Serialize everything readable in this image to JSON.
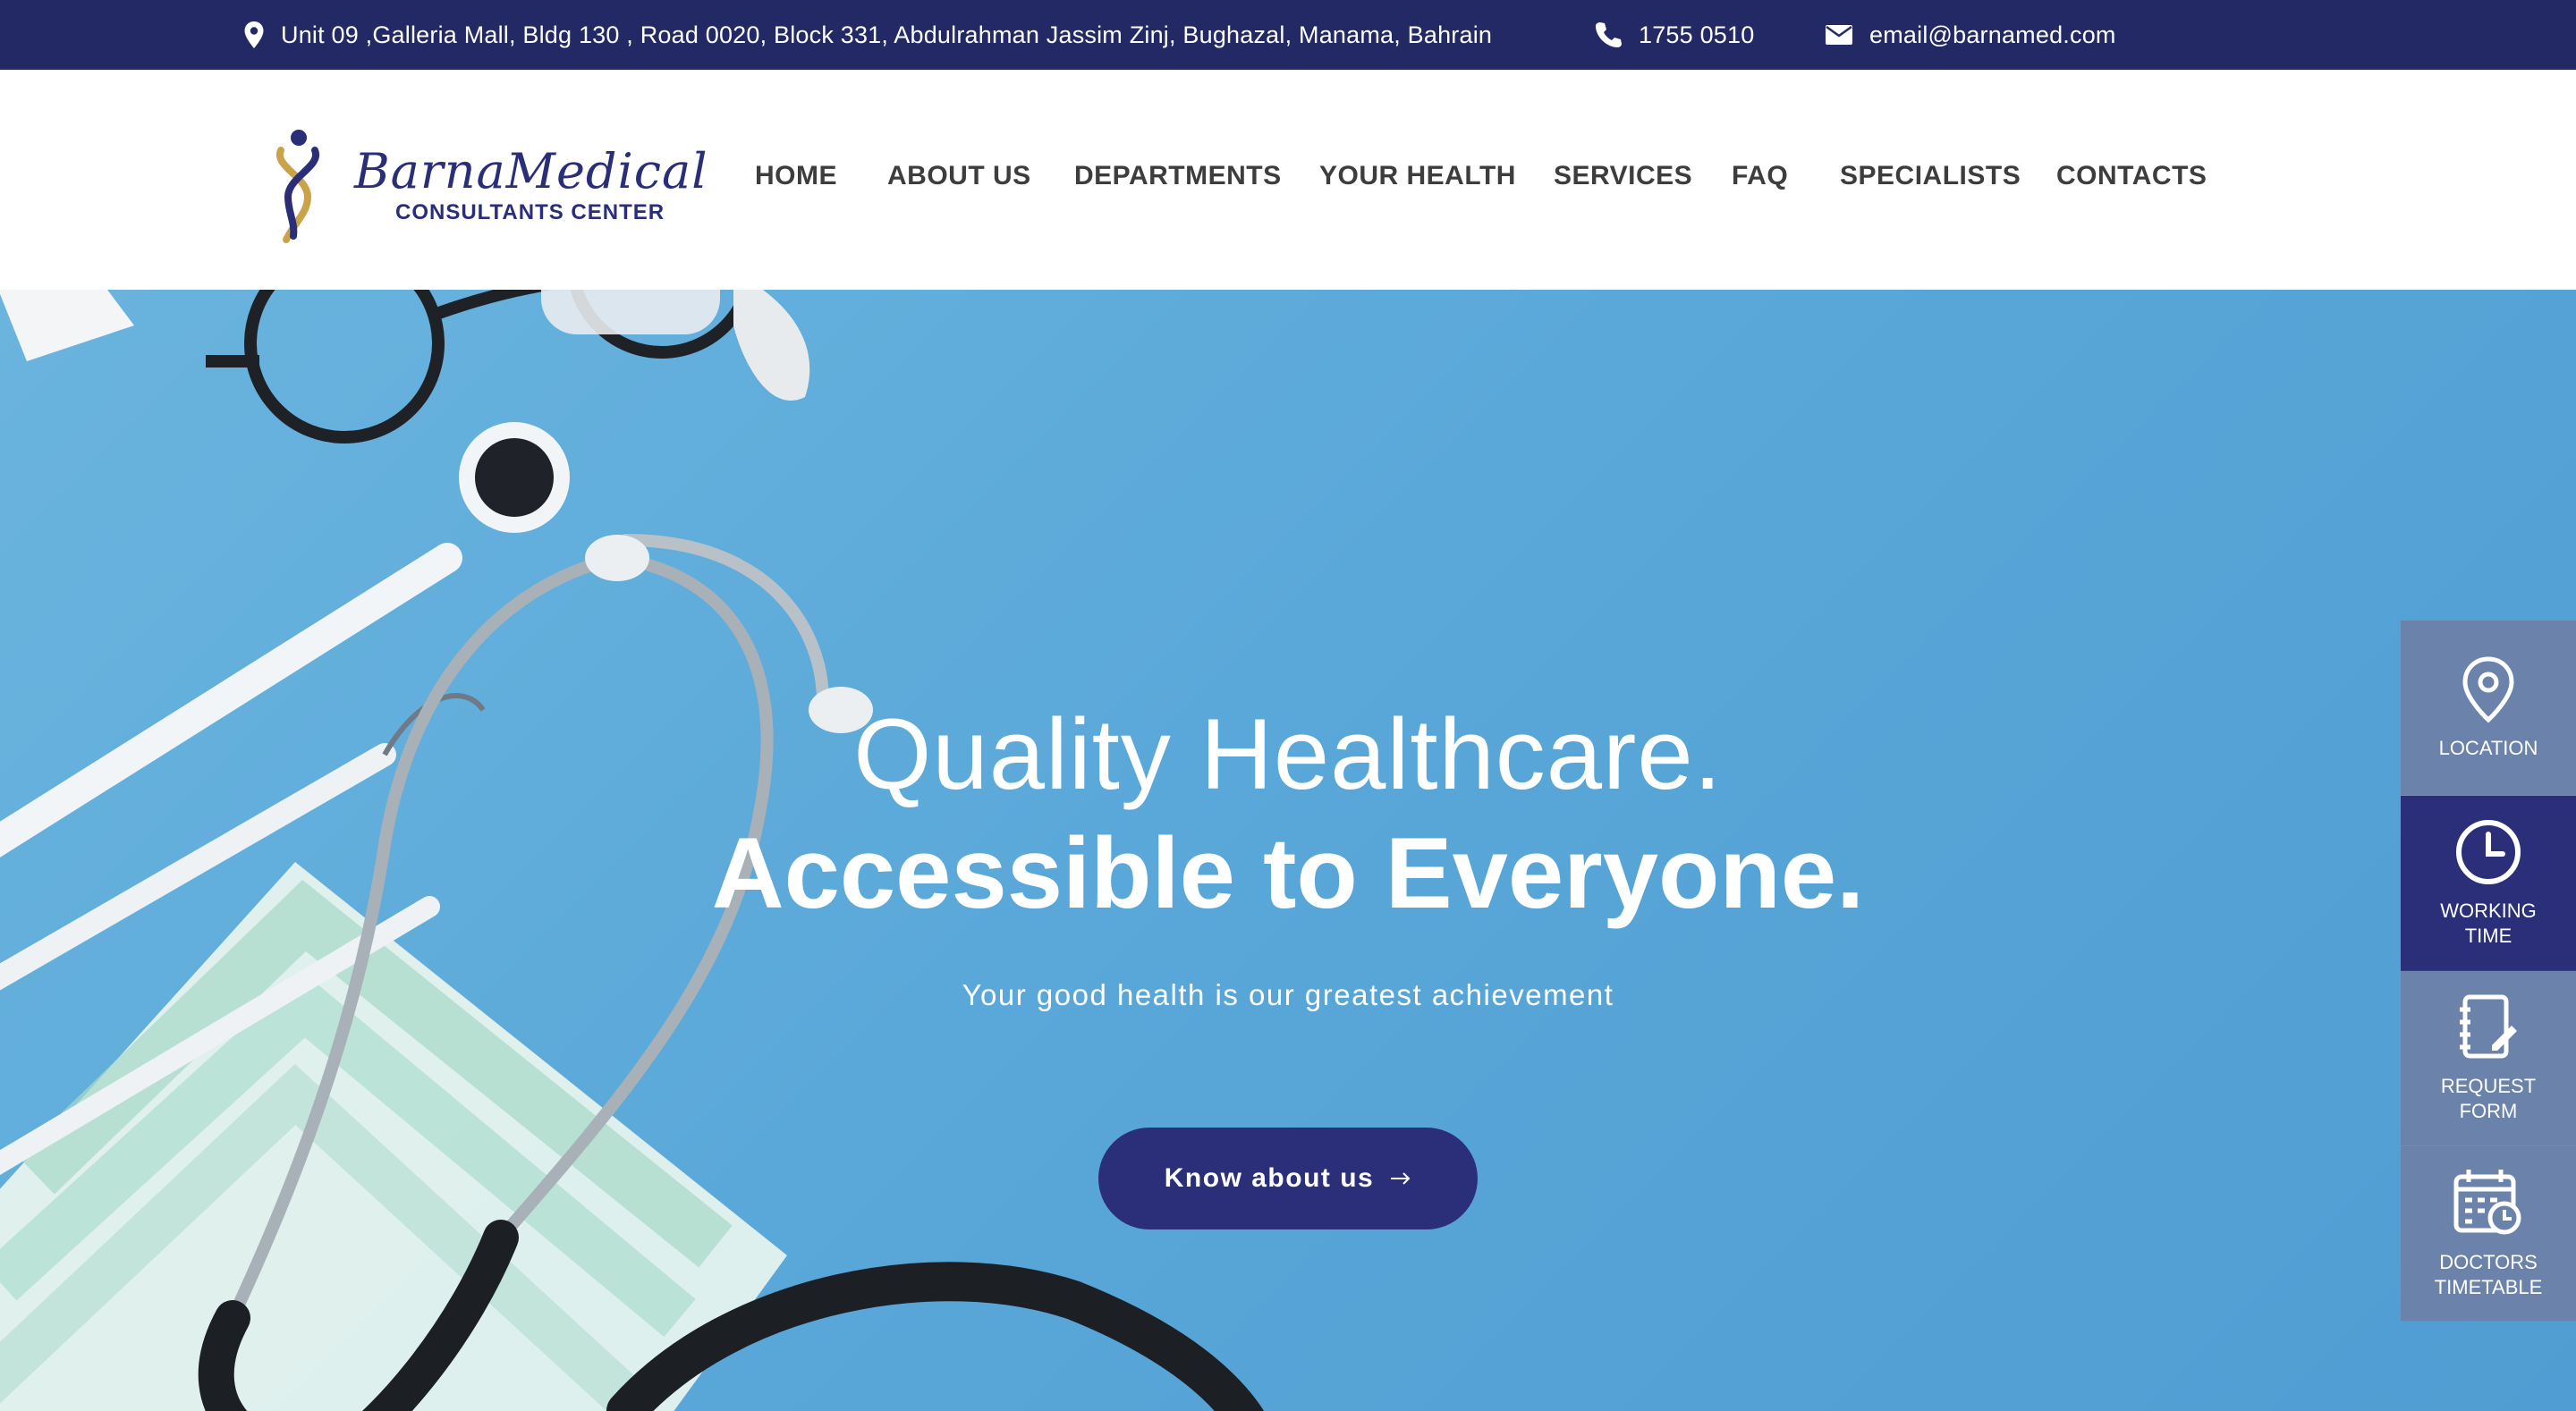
{
  "topbar": {
    "address": "Unit 09 ,Galleria Mall, Bldg 130 , Road 0020, Block 331, Abdulrahman Jassim Zinj, Bughazal, Manama, Bahrain",
    "phone": "1755 0510",
    "email": "email@barnamed.com",
    "address_icon": "map-pin-icon",
    "phone_icon": "phone-icon",
    "email_icon": "envelope-icon"
  },
  "logo": {
    "script": "BarnaMedical",
    "subtitle": "CONSULTANTS CENTER",
    "colors": {
      "navy": "#2a2d78",
      "gold": "#c9a24a"
    }
  },
  "nav": {
    "items": [
      {
        "label": "HOME"
      },
      {
        "label": "ABOUT US"
      },
      {
        "label": "DEPARTMENTS"
      },
      {
        "label": "YOUR HEALTH"
      },
      {
        "label": "SERVICES"
      },
      {
        "label": "FAQ"
      },
      {
        "label": "SPECIALISTS"
      },
      {
        "label": "CONTACTS"
      }
    ]
  },
  "hero": {
    "title_line1": "Quality Healthcare.",
    "title_line2": "Accessible to Everyone.",
    "subtitle": "Your good health is our greatest achievement",
    "button_label": "Know about us",
    "button_icon": "arrow-right-icon"
  },
  "side_widget": {
    "items": [
      {
        "label": "LOCATION",
        "icon": "location-pin-icon"
      },
      {
        "label": "WORKING TIME",
        "icon": "clock-icon",
        "active": true
      },
      {
        "label": "REQUEST FORM",
        "icon": "notebook-edit-icon"
      },
      {
        "label": "DOCTORS TIMETABLE",
        "icon": "calendar-clock-icon"
      }
    ]
  },
  "colors": {
    "topbar_bg": "#232964",
    "accent_navy": "#2b2f7a",
    "hero_blue": "#5aa8d9",
    "side_inactive": "#6b82aa"
  }
}
